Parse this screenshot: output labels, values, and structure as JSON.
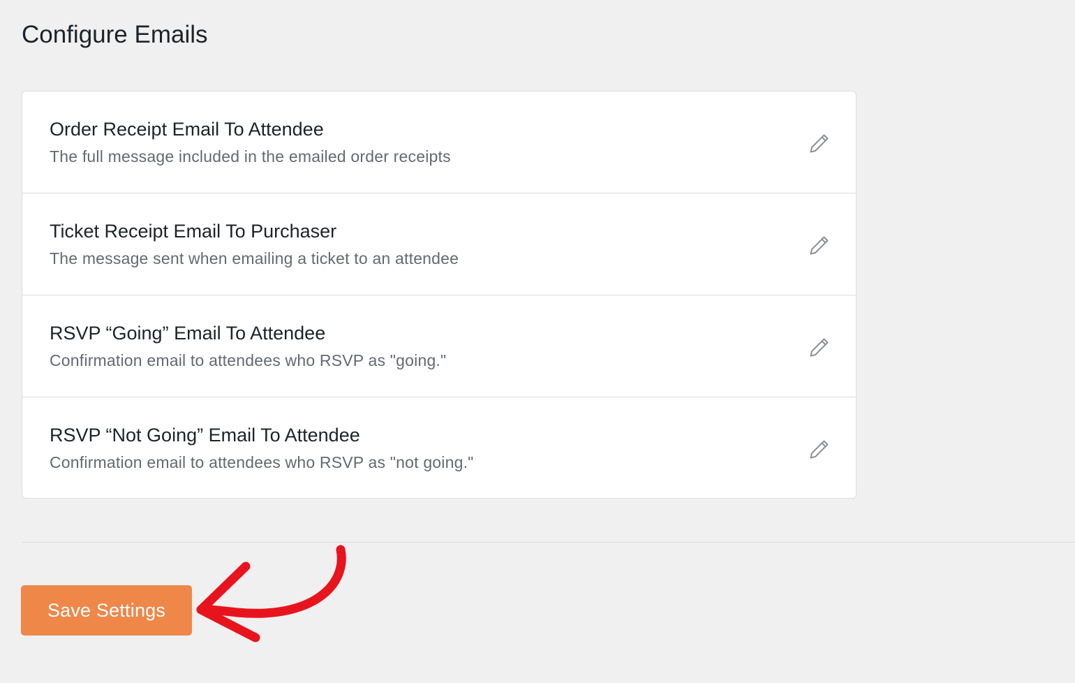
{
  "page": {
    "title": "Configure Emails"
  },
  "emails": [
    {
      "title": "Order Receipt Email To Attendee",
      "description": "The full message included in the emailed order receipts",
      "edit_icon": "pencil-icon"
    },
    {
      "title": "Ticket Receipt Email To Purchaser",
      "description": "The message sent when emailing a ticket to an attendee",
      "edit_icon": "pencil-icon"
    },
    {
      "title": "RSVP “Going” Email To Attendee",
      "description": "Confirmation email to attendees who RSVP as \"going.\"",
      "edit_icon": "pencil-icon"
    },
    {
      "title": "RSVP “Not Going” Email To Attendee",
      "description": "Confirmation email to attendees who RSVP as \"not going.\"",
      "edit_icon": "pencil-icon"
    }
  ],
  "actions": {
    "save_label": "Save Settings"
  },
  "colors": {
    "background": "#f0f0f1",
    "card": "#ffffff",
    "button": "#ee8748",
    "annotation_arrow": "#e8141d",
    "title_text": "#1d2327",
    "description_text": "#646970"
  }
}
